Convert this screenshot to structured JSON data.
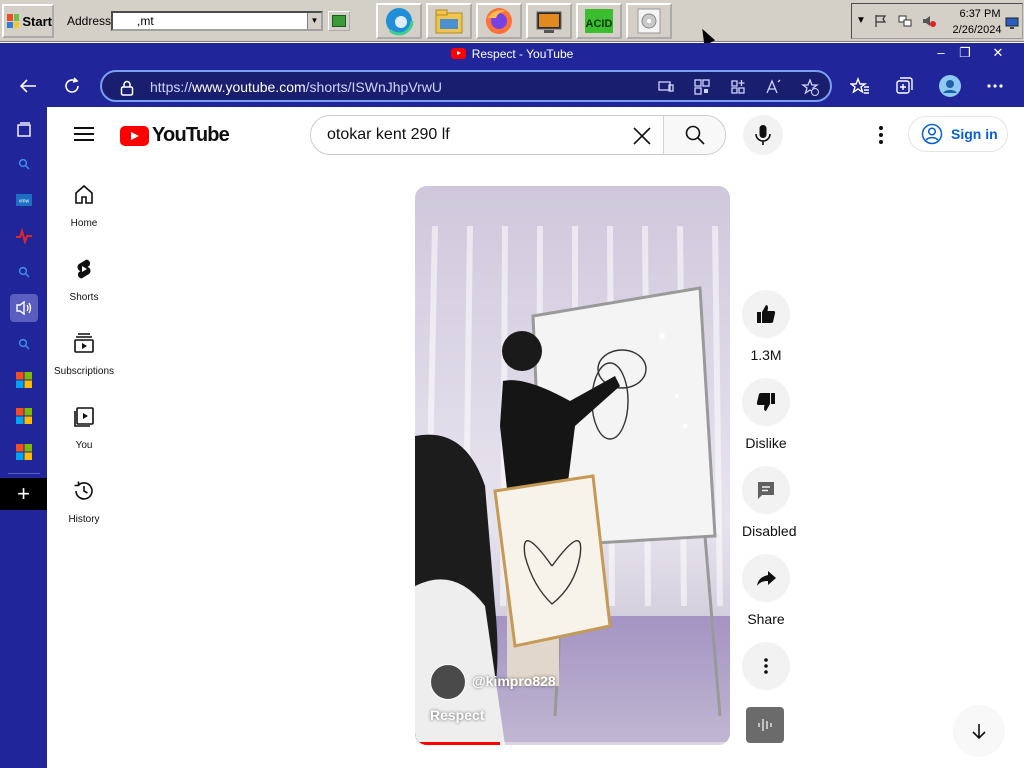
{
  "taskbar": {
    "start_label": "Start",
    "address_label": "Address",
    "address_value": ",mt",
    "apps": [
      {
        "icon": "edge-icon"
      },
      {
        "icon": "folder-icon"
      },
      {
        "icon": "firefox-icon"
      },
      {
        "icon": "media-center-icon"
      },
      {
        "icon": "acid-icon",
        "label": "ACID"
      },
      {
        "icon": "cd-icon"
      }
    ],
    "clock_time": "6:37 PM",
    "clock_date": "2/26/2024"
  },
  "browser": {
    "window_title": "Respect - YouTube",
    "url_prefix": "https://",
    "url_domain": "www.youtube.com",
    "url_path": "/shorts/ISWnJhpVrwU",
    "frame_color": "#202699",
    "url_border_color": "#7a9ff0"
  },
  "youtube": {
    "logo_text": "YouTube",
    "search_value": "otokar kent 290 lf",
    "signin_label": "Sign in",
    "guide": [
      {
        "label": "Home",
        "icon": "home-icon"
      },
      {
        "label": "Shorts",
        "icon": "shorts-icon"
      },
      {
        "label": "Subscriptions",
        "icon": "subscriptions-icon"
      },
      {
        "label": "You",
        "icon": "you-icon"
      },
      {
        "label": "History",
        "icon": "history-icon"
      }
    ],
    "short": {
      "channel": "@kimpro828",
      "title": "Respect",
      "progress": 0.27
    },
    "actions": {
      "like_count": "1.3M",
      "dislike_label": "Dislike",
      "comments_label": "Disabled",
      "share_label": "Share"
    },
    "brand_color": "#ff0000",
    "link_color": "#065fd4"
  }
}
